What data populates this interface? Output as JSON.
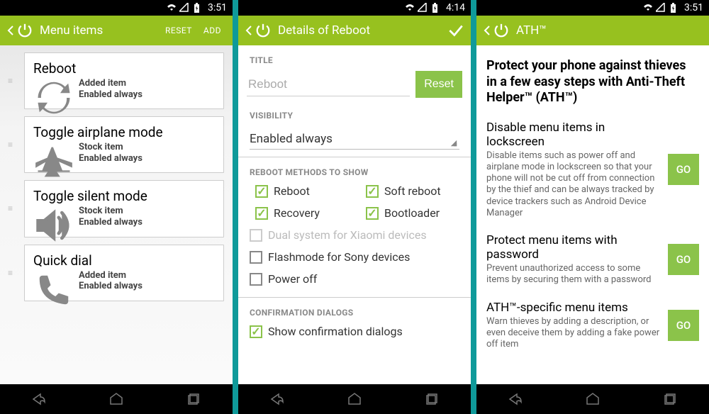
{
  "status": {
    "time1": "3:51",
    "time2": "4:14",
    "time3": "3:51"
  },
  "s1": {
    "title": "Menu items",
    "reset": "RESET",
    "add": "ADD",
    "items": [
      {
        "title": "Reboot",
        "line1": "Added item",
        "line2": "Enabled always"
      },
      {
        "title": "Toggle airplane mode",
        "line1": "Stock item",
        "line2": "Enabled always"
      },
      {
        "title": "Toggle silent mode",
        "line1": "Stock item",
        "line2": "Enabled always"
      },
      {
        "title": "Quick dial",
        "line1": "Added item",
        "line2": "Enabled always"
      }
    ]
  },
  "s2": {
    "title": "Details of Reboot",
    "hdr_title": "TITLE",
    "input_value": "Reboot",
    "reset_btn": "Reset",
    "hdr_vis": "VISIBILITY",
    "visibility": "Enabled always",
    "hdr_methods": "REBOOT METHODS TO SHOW",
    "methods": [
      {
        "label": "Reboot",
        "checked": true,
        "disabled": false
      },
      {
        "label": "Soft reboot",
        "checked": true,
        "disabled": false
      },
      {
        "label": "Recovery",
        "checked": true,
        "disabled": false
      },
      {
        "label": "Bootloader",
        "checked": true,
        "disabled": false
      }
    ],
    "extra": [
      {
        "label": "Dual system for Xiaomi devices",
        "checked": false,
        "disabled": true
      },
      {
        "label": "Flashmode for Sony devices",
        "checked": false,
        "disabled": false
      },
      {
        "label": "Power off",
        "checked": false,
        "disabled": false
      }
    ],
    "hdr_confirm": "CONFIRMATION DIALOGS",
    "confirm": {
      "label": "Show confirmation dialogs",
      "checked": true
    }
  },
  "s3": {
    "title": "ATH™",
    "intro": "Protect your phone against thieves in a few easy steps with Anti-Theft Helper™ (ATH™)",
    "go": "GO",
    "items": [
      {
        "title": "Disable menu items in lockscreen",
        "desc": "Disable items such as power off and airplane mode in lockscreen so that your phone will not be cut off from connection by the thief and can be always tracked by device trackers such as Android Device Manager"
      },
      {
        "title": "Protect menu items with password",
        "desc": "Prevent unauthorized access to some items by securing them with a password"
      },
      {
        "title": "ATH™-specific menu items",
        "desc": "Warn thieves by adding a description, or even deceive them by adding a fake power off item"
      }
    ]
  }
}
